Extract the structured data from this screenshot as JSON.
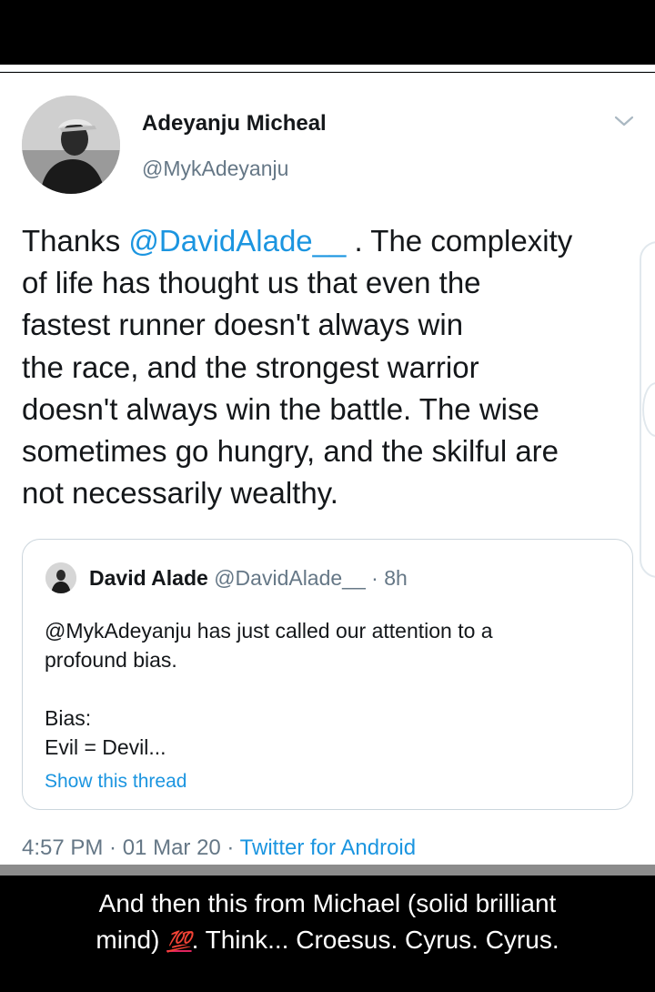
{
  "tweet": {
    "author": {
      "display_name": "Adeyanju Micheal",
      "handle": "@MykAdeyanju"
    },
    "text_lines": [
      {
        "before": "Thanks ",
        "mention": "@DavidAlade__",
        "after": " . The complexity"
      },
      {
        "text": "of life has thought us that even the"
      },
      {
        "text": "fastest runner doesn't always win"
      },
      {
        "text": "the race, and the strongest warrior"
      },
      {
        "text": "doesn't always win the battle. The wise"
      },
      {
        "text": "sometimes go hungry, and the skilful are"
      },
      {
        "text": "not necessarily wealthy."
      }
    ],
    "quoted": {
      "display_name": "David Alade",
      "meta": "@DavidAlade__ · 8h",
      "text": "@MykAdeyanju has just called our attention to a\nprofound bias.\n\nBias:\nEvil = Devil...",
      "show_thread_label": "Show this thread"
    },
    "timestamp": "4:57 PM · 01 Mar 20 · ",
    "source": "Twitter for Android"
  },
  "caption": {
    "line1": "And then this from Michael (solid brilliant",
    "line2_before": "mind) ",
    "emoji": "💯",
    "line2_after": ". Think... Croesus. Cyrus. Cyrus."
  },
  "colors": {
    "link": "#1b95e0",
    "text": "#14171a",
    "secondary": "#657786",
    "border": "#ccd6dd"
  },
  "icons": [
    "chevron-down-icon"
  ]
}
